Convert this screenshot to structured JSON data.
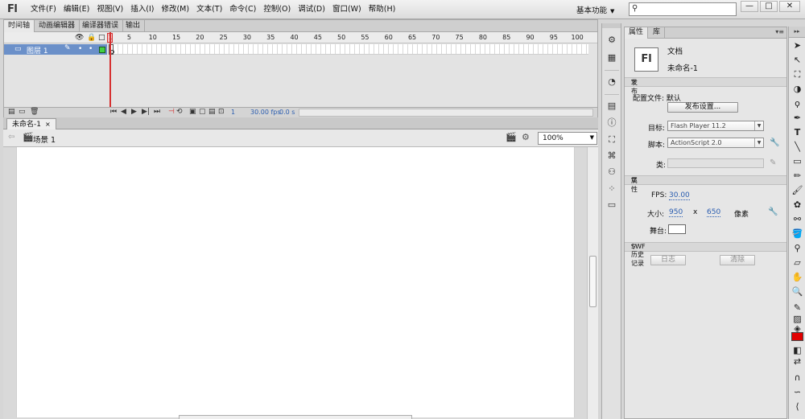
{
  "app": {
    "logo": "Fl",
    "menus": [
      "文件(F)",
      "编辑(E)",
      "视图(V)",
      "插入(I)",
      "修改(M)",
      "文本(T)",
      "命令(C)",
      "控制(O)",
      "调试(D)",
      "窗口(W)",
      "帮助(H)"
    ],
    "workspace": "基本功能",
    "search_placeholder": "",
    "window_controls": {
      "minimize": "—",
      "restore": "□",
      "close": "✕"
    }
  },
  "timeline": {
    "tabs": [
      "时间轴",
      "动画编辑器",
      "编译器错误",
      "输出"
    ],
    "ruler": [
      "1",
      "5",
      "10",
      "15",
      "20",
      "25",
      "30",
      "35",
      "40",
      "45",
      "50",
      "55",
      "60",
      "65",
      "70",
      "75",
      "80",
      "85",
      "90",
      "95",
      "100"
    ],
    "layer_name": "图层 1",
    "current_frame": "1",
    "fps": "30.00 fps",
    "elapsed": "0.0 s"
  },
  "document": {
    "tab_label": "未命名-1",
    "tab_close": "×",
    "scene": "场景 1",
    "zoom": "100%"
  },
  "properties": {
    "tabs": [
      "属性",
      "库"
    ],
    "doc_icon": "Fl",
    "doc_type": "文档",
    "doc_name": "未命名-1",
    "publish": {
      "header": "发布",
      "profile_label": "配置文件:",
      "profile_value": "默认",
      "settings_button": "发布设置...",
      "target_label": "目标:",
      "target_value": "Flash Player 11.2",
      "script_label": "脚本:",
      "script_value": "ActionScript 2.0",
      "class_label": "类:"
    },
    "props": {
      "header": "属性",
      "fps_label": "FPS:",
      "fps_value": "30.00",
      "size_label": "大小:",
      "width": "950",
      "x": "x",
      "height": "650",
      "unit": "像素",
      "stage_label": "舞台:",
      "stage_color": "#ffffff"
    },
    "swf_history": {
      "header": "SWF 历史记录",
      "log_button": "日志",
      "clear_button": "清除"
    }
  },
  "tools": {
    "fill_color": "#e00000"
  }
}
